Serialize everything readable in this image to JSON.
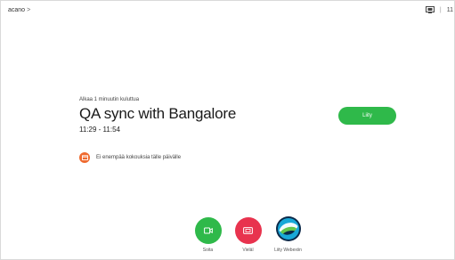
{
  "header": {
    "brand": "acano",
    "chevron": ">",
    "time": "11",
    "separator": "|",
    "screen_icon": "screen-share-icon"
  },
  "meeting": {
    "starts_in": "Alkaa 1 minuutin kuluttua",
    "title": "QA sync with Bangalore",
    "time_range": "11:29 - 11:54",
    "join_label": "Liity"
  },
  "notice": {
    "text": "Ei enempää kokouksia tälle päivälle",
    "icon": "calendar-icon"
  },
  "actions": [
    {
      "label": "Soita",
      "icon": "video-camera-icon",
      "color": "#2fb94a"
    },
    {
      "label": "Vieläl",
      "icon": "share-screen-icon",
      "color": "#e8334e"
    },
    {
      "label": "Liity Webexiin",
      "icon": "webex-icon",
      "color": "#ffffff"
    }
  ],
  "colors": {
    "accent_green": "#2fb94a",
    "accent_red": "#e8334e",
    "accent_orange": "#ef6a2f"
  }
}
